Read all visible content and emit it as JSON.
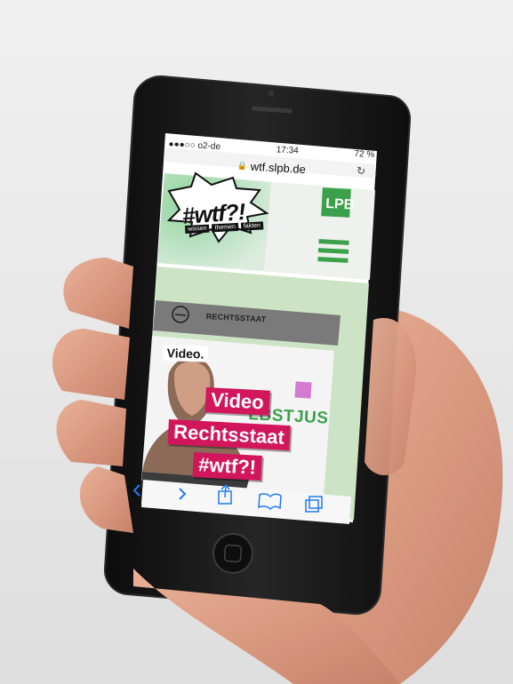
{
  "status_bar": {
    "carrier": "●●●○○ o2-de",
    "wifi_icon": "wifi-icon",
    "time": "17:34",
    "location_icon": "location-arrow-icon",
    "battery_percent": "72 %",
    "battery_level": 0.72
  },
  "url_bar": {
    "lock_icon": "lock-icon",
    "domain": "wtf.slpb.de",
    "reload_icon": "reload-icon"
  },
  "site_header": {
    "logo_word": "#wtf?!",
    "logo_tags": [
      "wissen",
      "themen",
      "fakten"
    ],
    "brand_logo": "LPB",
    "menu_icon": "hamburger-menu-icon"
  },
  "section": {
    "collapse_icon": "minus-circle-icon",
    "label": "RECHTSSTAAT"
  },
  "video_card": {
    "tag": "Video.",
    "title_lines": [
      "Video",
      "Rechtsstaat",
      "#wtf?!"
    ],
    "background_text": "LBSTJUS"
  },
  "toolbar": {
    "back_icon": "back-chevron-icon",
    "forward_icon": "forward-chevron-icon",
    "share_icon": "share-icon",
    "bookmarks_icon": "bookmarks-book-icon",
    "tabs_icon": "tabs-icon"
  },
  "colors": {
    "brand_green": "#3aa14a",
    "accent_magenta": "#d1165c",
    "section_gray": "#7a7a7a",
    "phone_body": "#151515"
  }
}
